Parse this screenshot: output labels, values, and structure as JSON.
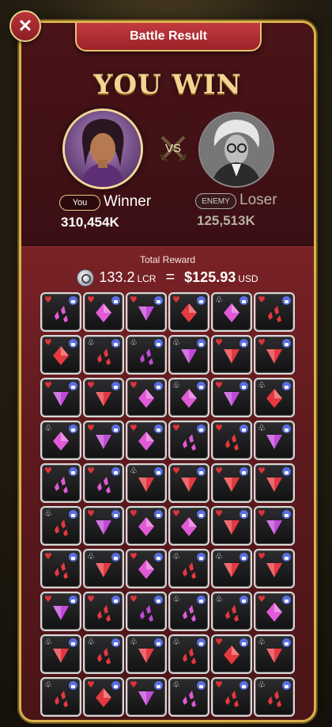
{
  "header": {
    "title": "Battle Result",
    "close_label": "✕"
  },
  "result_title": "YOU WIN",
  "vs_label": "VS",
  "player": {
    "tag": "You",
    "result": "Winner",
    "score": "310,454K"
  },
  "enemy": {
    "tag": "ENEMY",
    "result": "Loser",
    "score": "125,513K"
  },
  "reward": {
    "label": "Total Reward",
    "amount": "133.2",
    "amount_unit": "LCR",
    "equals": "=",
    "usd_amount": "$125.93",
    "usd_unit": "USD"
  },
  "colors": {
    "heart": "#e0333b",
    "club": "#ffffff",
    "gem_red": "#e5393f",
    "gem_pink": "#e05ad6",
    "gem_violet": "#c24ad8",
    "lock": "#5b6ee0"
  },
  "cards": [
    [
      "heart",
      "pink",
      "shards"
    ],
    [
      "heart",
      "pink",
      "diamond"
    ],
    [
      "heart",
      "violet",
      "triangle"
    ],
    [
      "heart",
      "red",
      "diamond"
    ],
    [
      "club",
      "pink",
      "diamond"
    ],
    [
      "heart",
      "red",
      "shards"
    ],
    [
      "heart",
      "red",
      "diamond"
    ],
    [
      "club",
      "red",
      "shards"
    ],
    [
      "club",
      "violet",
      "shards"
    ],
    [
      "club",
      "violet",
      "triangle"
    ],
    [
      "heart",
      "red",
      "triangle"
    ],
    [
      "heart",
      "red",
      "triangle"
    ],
    [
      "heart",
      "violet",
      "triangle"
    ],
    [
      "heart",
      "red",
      "triangle"
    ],
    [
      "heart",
      "pink",
      "diamond"
    ],
    [
      "club",
      "pink",
      "diamond"
    ],
    [
      "heart",
      "violet",
      "triangle"
    ],
    [
      "club",
      "red",
      "diamond"
    ],
    [
      "club",
      "pink",
      "diamond"
    ],
    [
      "heart",
      "violet",
      "triangle"
    ],
    [
      "heart",
      "pink",
      "diamond"
    ],
    [
      "heart",
      "pink",
      "shards"
    ],
    [
      "heart",
      "red",
      "shards"
    ],
    [
      "club",
      "violet",
      "triangle"
    ],
    [
      "heart",
      "pink",
      "shards"
    ],
    [
      "heart",
      "pink",
      "shards"
    ],
    [
      "club",
      "red",
      "triangle"
    ],
    [
      "heart",
      "red",
      "triangle"
    ],
    [
      "heart",
      "red",
      "triangle"
    ],
    [
      "heart",
      "red",
      "triangle"
    ],
    [
      "club",
      "red",
      "shards"
    ],
    [
      "heart",
      "violet",
      "triangle"
    ],
    [
      "heart",
      "pink",
      "diamond"
    ],
    [
      "heart",
      "pink",
      "diamond"
    ],
    [
      "heart",
      "red",
      "triangle"
    ],
    [
      "heart",
      "violet",
      "triangle"
    ],
    [
      "heart",
      "red",
      "shards"
    ],
    [
      "club",
      "red",
      "triangle"
    ],
    [
      "heart",
      "pink",
      "diamond"
    ],
    [
      "club",
      "red",
      "shards"
    ],
    [
      "club",
      "red",
      "triangle"
    ],
    [
      "heart",
      "red",
      "triangle"
    ],
    [
      "heart",
      "violet",
      "triangle"
    ],
    [
      "heart",
      "red",
      "shards"
    ],
    [
      "heart",
      "violet",
      "shards"
    ],
    [
      "club",
      "pink",
      "shards"
    ],
    [
      "club",
      "red",
      "shards"
    ],
    [
      "heart",
      "pink",
      "diamond"
    ],
    [
      "club",
      "red",
      "triangle"
    ],
    [
      "club",
      "red",
      "shards"
    ],
    [
      "club",
      "red",
      "triangle"
    ],
    [
      "club",
      "red",
      "shards"
    ],
    [
      "heart",
      "red",
      "diamond"
    ],
    [
      "club",
      "red",
      "triangle"
    ],
    [
      "club",
      "red",
      "shards"
    ],
    [
      "heart",
      "red",
      "diamond"
    ],
    [
      "heart",
      "violet",
      "triangle"
    ],
    [
      "club",
      "pink",
      "shards"
    ],
    [
      "heart",
      "red",
      "shards"
    ],
    [
      "club",
      "red",
      "shards"
    ],
    [
      "heart",
      "red",
      "diamond"
    ],
    [
      "heart",
      "red",
      "diamond"
    ],
    [
      "club",
      "pink",
      "diamond"
    ],
    [
      "heart",
      "red",
      "diamond"
    ],
    [
      "heart",
      "pink",
      "diamond"
    ],
    [
      "club",
      "red",
      "shards"
    ]
  ]
}
